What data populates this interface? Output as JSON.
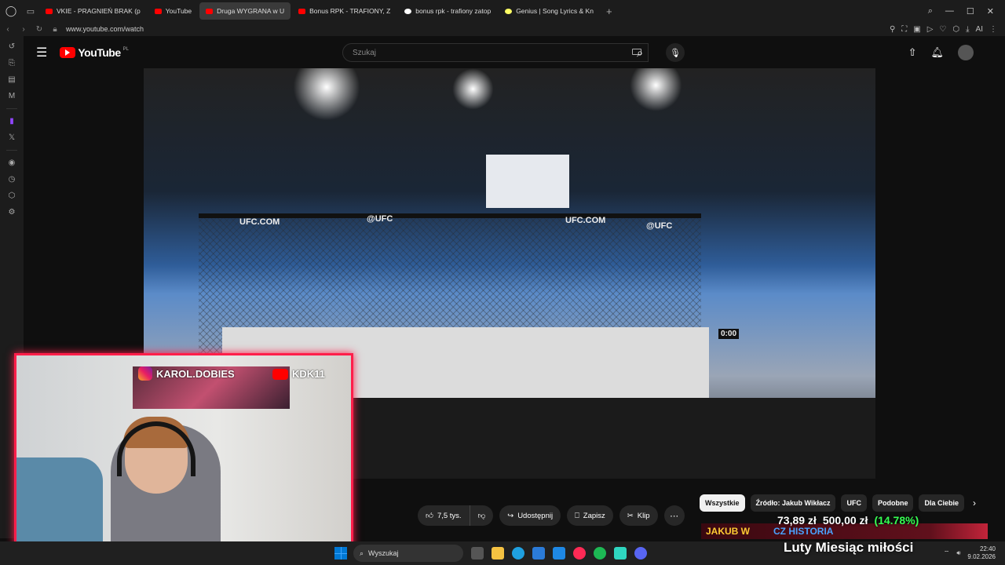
{
  "browser": {
    "tabs": [
      {
        "label": "VKIE - PRAGNIEŃ BRAK (p",
        "icon": "youtube-icon",
        "active": false
      },
      {
        "label": "YouTube",
        "icon": "youtube-icon",
        "active": false
      },
      {
        "label": "Druga WYGRANA w U",
        "icon": "youtube-icon",
        "active": true
      },
      {
        "label": "Bonus RPK - TRAFIONY, Z",
        "icon": "youtube-icon",
        "active": false
      },
      {
        "label": "bonus rpk - trafiony zatop",
        "icon": "google-icon",
        "active": false
      },
      {
        "label": "Genius | Song Lyrics & Kn",
        "icon": "genius-icon",
        "active": false
      }
    ],
    "url": "www.youtube.com/watch",
    "ai_label": "AI"
  },
  "youtube": {
    "logo_text": "YouTube",
    "region": "PL",
    "search_placeholder": "Szukaj"
  },
  "actions": {
    "likes": "7,5 tys.",
    "share": "Udostępnij",
    "save": "Zapisz",
    "clip": "Klip"
  },
  "chips": [
    "Wszystkie",
    "Źródło: Jakub Wikłacz",
    "UFC",
    "Podobne",
    "Dla Ciebie"
  ],
  "video": {
    "cage_ads": [
      "UFC.COM",
      "@UFC",
      "UFC.COM",
      "@UFC"
    ],
    "timer": "0:00"
  },
  "webcam": {
    "instagram_handle": "KAROL.DOBIES",
    "youtube_handle": "KDK11"
  },
  "stream_overlay": {
    "donation_a": "73,89 zł",
    "donation_b": "500,00 zł",
    "donation_c": "(14.78%)",
    "banner_a": "JAKUB W",
    "banner_b": "CZ HISTORIA",
    "title": "Luty Miesiąc miłości"
  },
  "taskbar": {
    "search_placeholder": "Wyszukaj",
    "time": "22:40",
    "date": "9.02.2026"
  },
  "colors": {
    "youtube_red": "#ff0000",
    "webcam_border": "#ff1e4a",
    "donation_green": "#36ff52"
  }
}
